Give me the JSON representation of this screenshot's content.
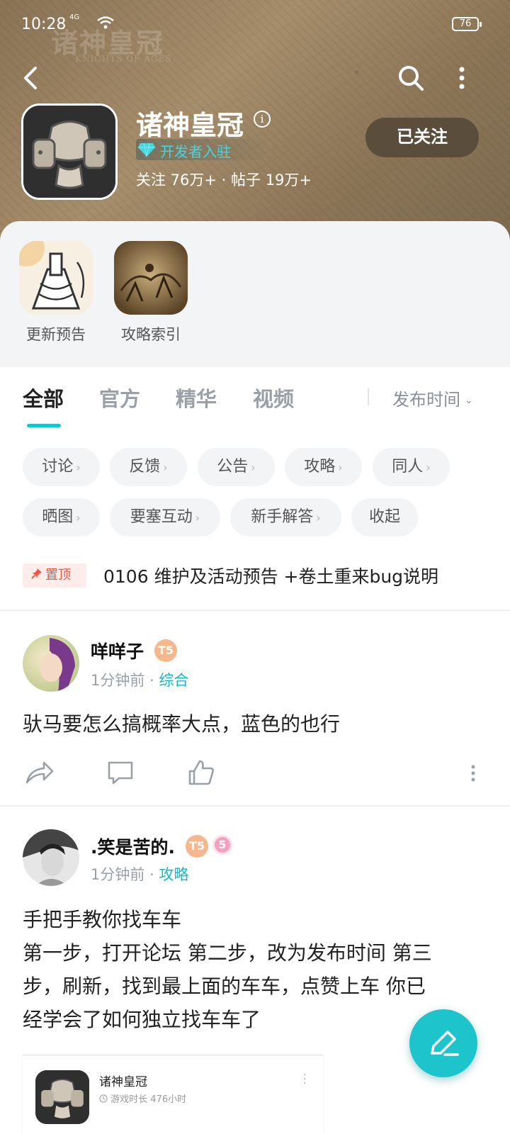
{
  "status_bar": {
    "time": "10:28",
    "network": "4G",
    "battery": "76"
  },
  "header": {
    "watermark": {
      "title": "诸神皇冠",
      "subtitle": "KNIGHTS OF AGES"
    },
    "game_title": "诸神皇冠",
    "developer_badge": "开发者入驻",
    "stats": "关注 76万+ · 帖子 19万+",
    "follow_button": "已关注"
  },
  "quick_entries": [
    {
      "label": "更新预告"
    },
    {
      "label": "攻略索引"
    }
  ],
  "tabs": {
    "items": [
      {
        "label": "全部"
      },
      {
        "label": "官方"
      },
      {
        "label": "精华"
      },
      {
        "label": "视频"
      }
    ],
    "sort_label": "发布时间"
  },
  "chips": [
    {
      "label": "讨论",
      "arrow": "›"
    },
    {
      "label": "反馈",
      "arrow": "›"
    },
    {
      "label": "公告",
      "arrow": "›"
    },
    {
      "label": "攻略",
      "arrow": "›"
    },
    {
      "label": "同人",
      "arrow": "›"
    },
    {
      "label": "晒图",
      "arrow": "›"
    },
    {
      "label": "要塞互动",
      "arrow": "›"
    },
    {
      "label": "新手解答",
      "arrow": "›"
    },
    {
      "label": "收起"
    }
  ],
  "pinned": {
    "badge": "置顶",
    "title": "0106 维护及活动预告 +卷土重来bug说明"
  },
  "posts": [
    {
      "username": "咩咩子",
      "level": "T5",
      "time": "1分钟前",
      "separator": "·",
      "category": "综合",
      "body": "驮马要怎么搞概率大点，蓝色的也行"
    },
    {
      "username": ".笑是苦的.",
      "level": "T5",
      "extra_badge": "5",
      "time": "1分钟前",
      "separator": "·",
      "category": "攻略",
      "body_lines": [
        "手把手教你找车车",
        "第一步，打开论坛 第二步，改为发布时间 第三",
        "步，刷新，找到最上面的车车，点赞上车 你已",
        "经学会了如何独立找车车了"
      ]
    }
  ],
  "embed_card": {
    "name": "诸神皇冠",
    "sub": "游戏时长 476小时"
  },
  "colors": {
    "accent": "#15c5ce",
    "pin_red": "#f0553f",
    "header_brown": "#8a7355"
  }
}
